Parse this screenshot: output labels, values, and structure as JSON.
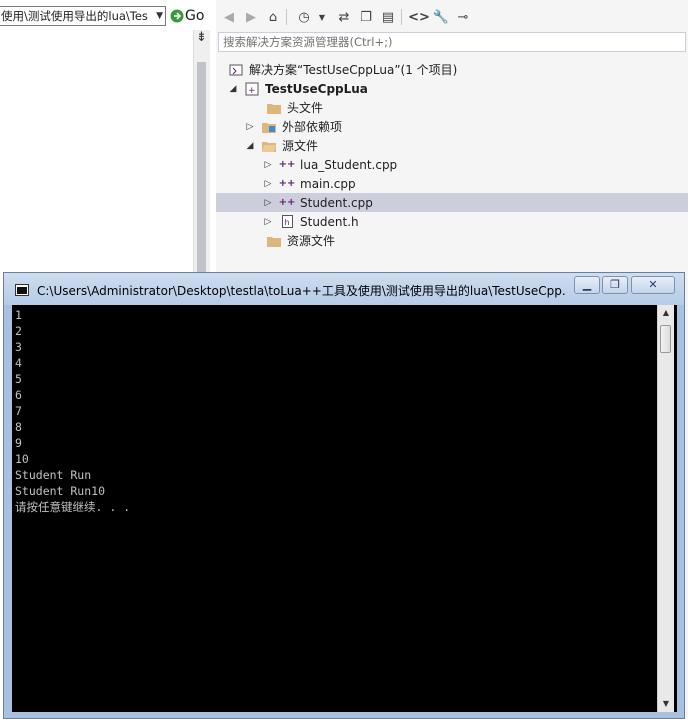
{
  "editor": {
    "nav_path": "使用\\测试使用导出的lua\\Tes",
    "go_label": "Go"
  },
  "solution_explorer": {
    "search_placeholder": "搜索解决方案资源管理器(Ctrl+;)",
    "tree": {
      "solution": "解决方案“TestUseCppLua”(1 个项目)",
      "project": "TestUseCppLua",
      "header_files": "头文件",
      "external_deps": "外部依赖项",
      "source_files": "源文件",
      "file_lua_student": "lua_Student.cpp",
      "file_main": "main.cpp",
      "file_student_cpp": "Student.cpp",
      "file_student_h": "Student.h",
      "resource_files": "资源文件"
    }
  },
  "console": {
    "title": "C:\\Users\\Administrator\\Desktop\\testla\\toLua++工具及使用\\测试使用导出的lua\\TestUseCpp...",
    "output": "1\n2\n3\n4\n5\n6\n7\n8\n9\n10\nStudent Run\nStudent Run10\n请按任意键继续. . ."
  },
  "colors": {
    "console_bg": "#000000",
    "console_text": "#c0c0c0",
    "selection": "#cccedb",
    "folder": "#dcb67a",
    "cpp_icon": "#68217a"
  }
}
